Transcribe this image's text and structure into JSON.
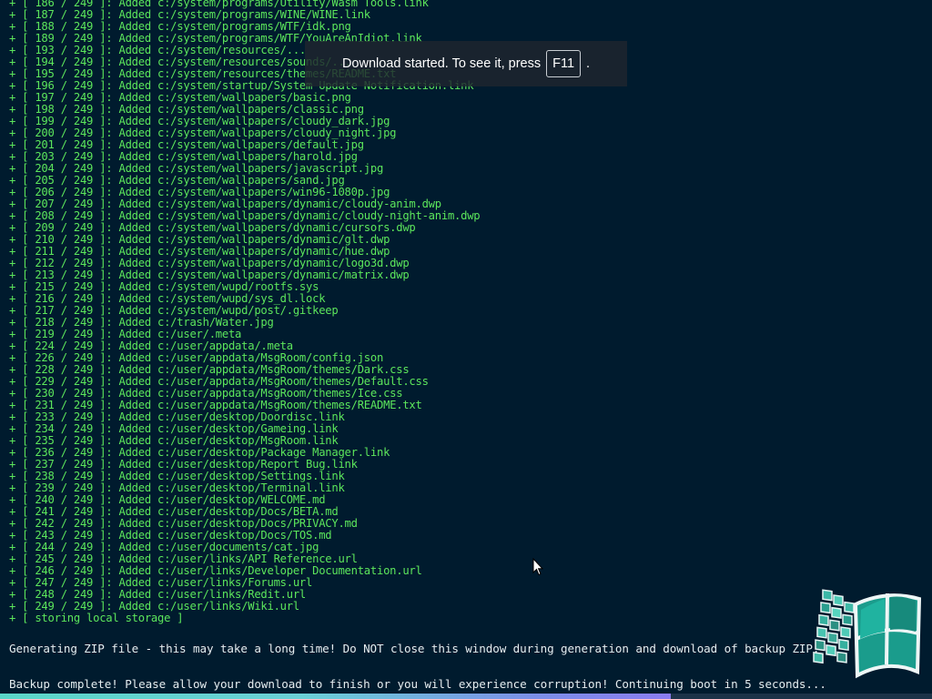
{
  "log_lines": [
    "+ [ 186 / 249 ]: Added c:/system/programs/Utility/Wasm Tools.link",
    "+ [ 187 / 249 ]: Added c:/system/programs/WINE/WINE.link",
    "+ [ 188 / 249 ]: Added c:/system/programs/WTF/idk.png",
    "+ [ 189 / 249 ]: Added c:/system/programs/WTF/YouAreAnIdiot.link",
    "+ [ 193 / 249 ]: Added c:/system/resources/...",
    "+ [ 194 / 249 ]: Added c:/system/resources/sounds/...",
    "+ [ 195 / 249 ]: Added c:/system/resources/themes/README.txt",
    "+ [ 196 / 249 ]: Added c:/system/startup/System Update Notification.link",
    "+ [ 197 / 249 ]: Added c:/system/wallpapers/basic.png",
    "+ [ 198 / 249 ]: Added c:/system/wallpapers/classic.png",
    "+ [ 199 / 249 ]: Added c:/system/wallpapers/cloudy_dark.jpg",
    "+ [ 200 / 249 ]: Added c:/system/wallpapers/cloudy_night.jpg",
    "+ [ 201 / 249 ]: Added c:/system/wallpapers/default.jpg",
    "+ [ 203 / 249 ]: Added c:/system/wallpapers/harold.jpg",
    "+ [ 204 / 249 ]: Added c:/system/wallpapers/javascript.jpg",
    "+ [ 205 / 249 ]: Added c:/system/wallpapers/sand.jpg",
    "+ [ 206 / 249 ]: Added c:/system/wallpapers/win96-1080p.jpg",
    "+ [ 207 / 249 ]: Added c:/system/wallpapers/dynamic/cloudy-anim.dwp",
    "+ [ 208 / 249 ]: Added c:/system/wallpapers/dynamic/cloudy-night-anim.dwp",
    "+ [ 209 / 249 ]: Added c:/system/wallpapers/dynamic/cursors.dwp",
    "+ [ 210 / 249 ]: Added c:/system/wallpapers/dynamic/glt.dwp",
    "+ [ 211 / 249 ]: Added c:/system/wallpapers/dynamic/hue.dwp",
    "+ [ 212 / 249 ]: Added c:/system/wallpapers/dynamic/logo3d.dwp",
    "+ [ 213 / 249 ]: Added c:/system/wallpapers/dynamic/matrix.dwp",
    "+ [ 215 / 249 ]: Added c:/system/wupd/rootfs.sys",
    "+ [ 216 / 249 ]: Added c:/system/wupd/sys_dl.lock",
    "+ [ 217 / 249 ]: Added c:/system/wupd/post/.gitkeep",
    "+ [ 218 / 249 ]: Added c:/trash/Water.jpg",
    "+ [ 219 / 249 ]: Added c:/user/.meta",
    "+ [ 224 / 249 ]: Added c:/user/appdata/.meta",
    "+ [ 226 / 249 ]: Added c:/user/appdata/MsgRoom/config.json",
    "+ [ 228 / 249 ]: Added c:/user/appdata/MsgRoom/themes/Dark.css",
    "+ [ 229 / 249 ]: Added c:/user/appdata/MsgRoom/themes/Default.css",
    "+ [ 230 / 249 ]: Added c:/user/appdata/MsgRoom/themes/Ice.css",
    "+ [ 231 / 249 ]: Added c:/user/appdata/MsgRoom/themes/README.txt",
    "+ [ 233 / 249 ]: Added c:/user/desktop/Doordisc.link",
    "+ [ 234 / 249 ]: Added c:/user/desktop/Gameing.link",
    "+ [ 235 / 249 ]: Added c:/user/desktop/MsgRoom.link",
    "+ [ 236 / 249 ]: Added c:/user/desktop/Package Manager.link",
    "+ [ 237 / 249 ]: Added c:/user/desktop/Report Bug.link",
    "+ [ 238 / 249 ]: Added c:/user/desktop/Settings.link",
    "+ [ 239 / 249 ]: Added c:/user/desktop/Terminal.link",
    "+ [ 240 / 249 ]: Added c:/user/desktop/WELCOME.md",
    "+ [ 241 / 249 ]: Added c:/user/desktop/Docs/BETA.md",
    "+ [ 242 / 249 ]: Added c:/user/desktop/Docs/PRIVACY.md",
    "+ [ 243 / 249 ]: Added c:/user/desktop/Docs/TOS.md",
    "+ [ 244 / 249 ]: Added c:/user/documents/cat.jpg",
    "+ [ 245 / 249 ]: Added c:/user/links/API Reference.url",
    "+ [ 246 / 249 ]: Added c:/user/links/Developer Documentation.url",
    "+ [ 247 / 249 ]: Added c:/user/links/Forums.url",
    "+ [ 248 / 249 ]: Added c:/user/links/Redit.url",
    "+ [ 249 / 249 ]: Added c:/user/links/Wiki.url",
    "+ [ storing local storage ]"
  ],
  "messages": {
    "generating_zip": "Generating ZIP file - this may take a long time! Do NOT close this window during generation and download of backup ZIP.",
    "backup_complete": "Backup complete! Please allow your download to finish or you will experience corruption! Continuing boot in 5 seconds..."
  },
  "download_toast": {
    "text": "Download started. To see it, press",
    "key": "F11",
    "suffix": "."
  },
  "progress": {
    "fraction": 0.72
  },
  "icons": {
    "logo": "windows-96-logo-icon",
    "cursor": "mouse-pointer-icon"
  },
  "colors": {
    "background": "#001b2e",
    "log_text": "#5ce65c",
    "message_text": "#e6ecef"
  }
}
